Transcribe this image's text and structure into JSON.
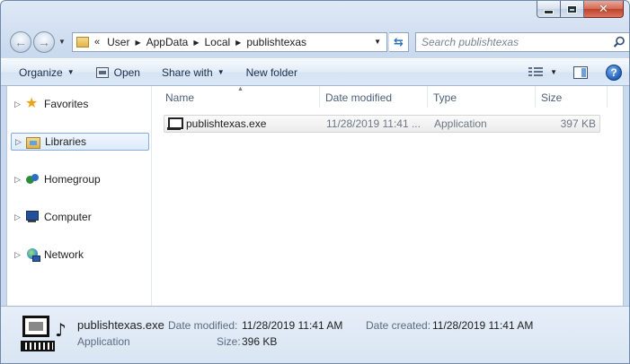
{
  "address": {
    "chevrons": "«",
    "crumbs": [
      "User",
      "AppData",
      "Local",
      "publishtexas"
    ]
  },
  "search": {
    "placeholder": "Search publishtexas"
  },
  "toolbar": {
    "organize": "Organize",
    "open": "Open",
    "share_with": "Share with",
    "new_folder": "New folder"
  },
  "nav": {
    "items": [
      {
        "label": "Favorites",
        "icon": "star-icon"
      },
      {
        "label": "Libraries",
        "icon": "libraries-icon",
        "selected": true
      },
      {
        "label": "Homegroup",
        "icon": "homegroup-icon"
      },
      {
        "label": "Computer",
        "icon": "computer-icon"
      },
      {
        "label": "Network",
        "icon": "network-icon"
      }
    ]
  },
  "columns": {
    "name": "Name",
    "date_modified": "Date modified",
    "type": "Type",
    "size": "Size"
  },
  "files": [
    {
      "name": "publishtexas.exe",
      "date_modified": "11/28/2019 11:41 ...",
      "type": "Application",
      "size": "397 KB"
    }
  ],
  "details": {
    "filename": "publishtexas.exe",
    "type": "Application",
    "date_modified_label": "Date modified:",
    "date_modified": "11/28/2019 11:41 AM",
    "date_created_label": "Date created:",
    "date_created": "11/28/2019 11:41 AM",
    "size_label": "Size:",
    "size": "396 KB"
  },
  "colors": {
    "accent": "#2e6fb8",
    "selection": "#dcebfc"
  }
}
